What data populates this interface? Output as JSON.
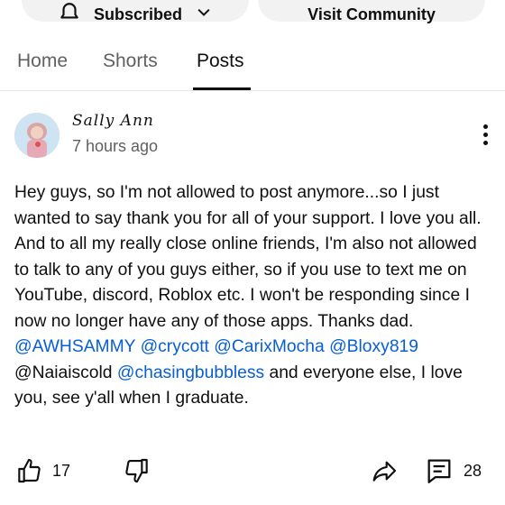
{
  "header_buttons": {
    "subscribed_label": "Subscribed",
    "visit_label": "Visit Community"
  },
  "tabs": [
    {
      "label": "Home",
      "active": false
    },
    {
      "label": "Shorts",
      "active": false
    },
    {
      "label": "Posts",
      "active": true
    }
  ],
  "post": {
    "author": "Sally Ann",
    "time": "7 hours ago",
    "text_before": "Hey guys, so I'm not allowed to post anymore...so I just wanted to say thank you for all of your support. I love you all. And to all my really close online friends, I'm also not allowed to talk to any of you guys either, so if you use to text me on YouTube, discord, Roblox etc. I won't be responding since I now no longer have any of those apps. Thanks dad. ",
    "mention_1": "@AWHSAMMY",
    "mention_2": "@crycott",
    "mention_3": "@CarixMocha",
    "mention_4": "@Bloxy819",
    "plain_mention": " @Naiaiscold",
    "mention_5": "@chasingbubbless",
    "text_after": " and everyone else, I love you, see y'all when I graduate.",
    "likes": "17",
    "comments": "28"
  },
  "icons": {
    "bell": "bell-icon",
    "chevron": "chevron-down-icon",
    "more": "more-vert-icon",
    "like": "thumbs-up-icon",
    "dislike": "thumbs-down-icon",
    "share": "share-icon",
    "comment": "comment-icon"
  },
  "colors": {
    "mention": "#065fd4",
    "text": "#0f0f0f",
    "secondary": "#606060"
  }
}
